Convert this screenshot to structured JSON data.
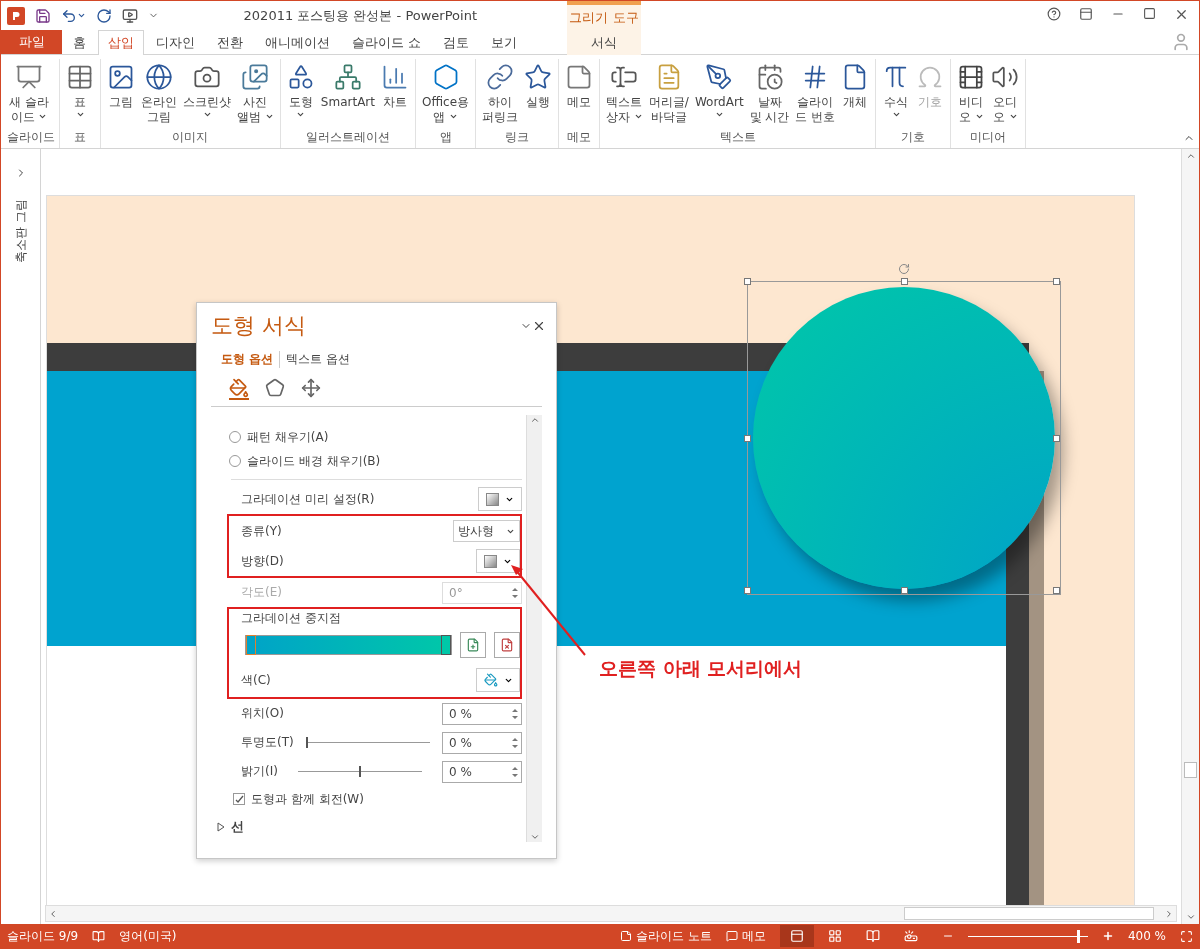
{
  "window": {
    "title": "202011 포스팅용 완성본 - PowerPoint",
    "contextual_group": "그리기 도구"
  },
  "file_tab": "파일",
  "tabs": [
    {
      "label": "홈",
      "selected": false
    },
    {
      "label": "삽입",
      "selected": true
    },
    {
      "label": "디자인",
      "selected": false
    },
    {
      "label": "전환",
      "selected": false
    },
    {
      "label": "애니메이션",
      "selected": false
    },
    {
      "label": "슬라이드 쇼",
      "selected": false
    },
    {
      "label": "검토",
      "selected": false
    },
    {
      "label": "보기",
      "selected": false
    }
  ],
  "contextual_tabs": [
    {
      "label": "서식",
      "selected": false
    }
  ],
  "ribbon_groups": [
    {
      "label": "슬라이드",
      "commands": [
        {
          "lines": [
            "새 슬라",
            "이드"
          ],
          "dropdown": true,
          "disabled": false
        }
      ]
    },
    {
      "label": "표",
      "commands": [
        {
          "lines": [
            "표"
          ],
          "dropdown": true,
          "disabled": false
        }
      ]
    },
    {
      "label": "이미지",
      "commands": [
        {
          "lines": [
            "그림"
          ],
          "dropdown": false,
          "disabled": false
        },
        {
          "lines": [
            "온라인",
            "그림"
          ],
          "dropdown": false,
          "disabled": false
        },
        {
          "lines": [
            "스크린샷"
          ],
          "dropdown": true,
          "disabled": false
        },
        {
          "lines": [
            "사진",
            "앨범"
          ],
          "dropdown": true,
          "disabled": false
        }
      ]
    },
    {
      "label": "일러스트레이션",
      "commands": [
        {
          "lines": [
            "도형"
          ],
          "dropdown": true,
          "disabled": false
        },
        {
          "lines": [
            "SmartArt"
          ],
          "dropdown": false,
          "disabled": false
        },
        {
          "lines": [
            "차트"
          ],
          "dropdown": false,
          "disabled": false
        }
      ]
    },
    {
      "label": "앱",
      "commands": [
        {
          "lines": [
            "Office용",
            "앱"
          ],
          "dropdown": true,
          "disabled": false
        }
      ]
    },
    {
      "label": "링크",
      "commands": [
        {
          "lines": [
            "하이",
            "퍼링크"
          ],
          "dropdown": false,
          "disabled": false
        },
        {
          "lines": [
            "실행"
          ],
          "dropdown": false,
          "disabled": false
        }
      ]
    },
    {
      "label": "메모",
      "commands": [
        {
          "lines": [
            "메모"
          ],
          "dropdown": false,
          "disabled": false
        }
      ]
    },
    {
      "label": "텍스트",
      "commands": [
        {
          "lines": [
            "텍스트",
            "상자"
          ],
          "dropdown": true,
          "disabled": false
        },
        {
          "lines": [
            "머리글/",
            "바닥글"
          ],
          "dropdown": false,
          "disabled": false
        },
        {
          "lines": [
            "WordArt"
          ],
          "dropdown": true,
          "disabled": false
        },
        {
          "lines": [
            "날짜",
            "및 시간"
          ],
          "dropdown": false,
          "disabled": false
        },
        {
          "lines": [
            "슬라이",
            "드 번호"
          ],
          "dropdown": false,
          "disabled": false
        },
        {
          "lines": [
            "개체"
          ],
          "dropdown": false,
          "disabled": false
        }
      ]
    },
    {
      "label": "기호",
      "commands": [
        {
          "lines": [
            "수식"
          ],
          "dropdown": true,
          "disabled": false
        },
        {
          "lines": [
            "기호"
          ],
          "dropdown": false,
          "disabled": true
        }
      ]
    },
    {
      "label": "미디어",
      "commands": [
        {
          "lines": [
            "비디",
            "오"
          ],
          "dropdown": true,
          "disabled": false
        },
        {
          "lines": [
            "오디",
            "오"
          ],
          "dropdown": true,
          "disabled": false
        }
      ]
    }
  ],
  "thumbnail_pane": {
    "label": "축소판 그림"
  },
  "format_pane": {
    "title": "도형 서식",
    "tabs": [
      {
        "label": "도형 옵션",
        "selected": true
      },
      {
        "label": "텍스트 옵션",
        "selected": false
      }
    ],
    "icon_tabs": [
      {
        "selected": true
      },
      {
        "selected": false
      },
      {
        "selected": false
      }
    ],
    "fill_options": [
      {
        "label": "패턴 채우기(A)",
        "selected": false
      },
      {
        "label": "슬라이드 배경 채우기(B)",
        "selected": false
      }
    ],
    "gradient_rows": [
      {
        "kind": "gallery",
        "label": "그라데이션 미리 설정(R)",
        "disabled": false,
        "highlighted": false
      },
      {
        "kind": "dropdown",
        "label": "종류(Y)",
        "value": "방사형",
        "disabled": false,
        "highlighted": true
      },
      {
        "kind": "gallery",
        "label": "방향(D)",
        "disabled": false,
        "highlighted": true
      },
      {
        "kind": "spinner",
        "label": "각도(E)",
        "value": "0°",
        "disabled": true,
        "highlighted": false
      },
      {
        "kind": "stops",
        "label": "그라데이션 중지점",
        "disabled": false,
        "highlighted": true,
        "stops": [
          {
            "color": "#00a3c8",
            "level": 0,
            "selected": true
          },
          {
            "color": "#00c8a8",
            "level": 1,
            "selected": false
          }
        ]
      },
      {
        "kind": "color",
        "label": "색(C)",
        "disabled": false,
        "highlighted": true
      },
      {
        "kind": "spinner",
        "label": "위치(O)",
        "value": "0 %",
        "disabled": false,
        "highlighted": false
      },
      {
        "kind": "slider",
        "label": "투명도(T)",
        "value": "0 %",
        "level": 0,
        "disabled": false,
        "highlighted": false
      },
      {
        "kind": "slider",
        "label": "밝기(I)",
        "value": "0 %",
        "level": 0.5,
        "disabled": false,
        "highlighted": false
      },
      {
        "kind": "checkbox",
        "label": "도형과 함께 회전(W)",
        "checked": true,
        "disabled": false,
        "highlighted": false
      }
    ],
    "line_section": {
      "label": "선",
      "expanded": false
    }
  },
  "annotation": {
    "text": "오른쪽 아래 모서리에서"
  },
  "status_bar": {
    "slide": "슬라이드 9/9",
    "language": "영어(미국)",
    "notes": "슬라이드 노트",
    "comments": "메모",
    "views": [
      {
        "selected": true
      },
      {
        "selected": false
      },
      {
        "selected": false
      },
      {
        "selected": false
      }
    ],
    "zoom_slider": {
      "level": 0.93
    },
    "zoom": "400 %"
  }
}
